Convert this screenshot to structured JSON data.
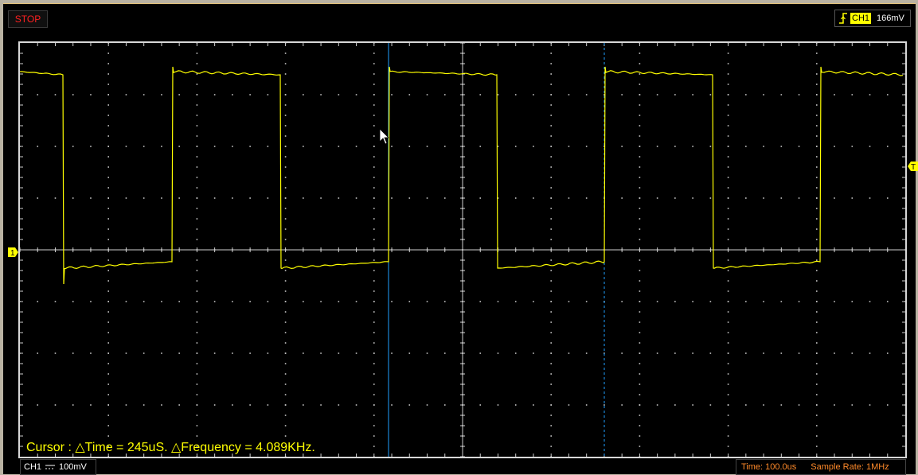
{
  "status": {
    "label": "STOP"
  },
  "trigger": {
    "channel": "CH1",
    "level": "166mV",
    "edge_icon": "rising-edge-icon"
  },
  "channel_marker": {
    "label": "1"
  },
  "trigger_marker": {
    "label": "T"
  },
  "cursor": {
    "readout": "Cursor : △Time = 245uS.  △Frequency = 4.089KHz."
  },
  "channel_info": {
    "channel": "CH1",
    "coupling_icon": "dc-coupling-icon",
    "scale": "100mV"
  },
  "timebase": {
    "time": "Time: 100.0us",
    "sample_rate": "Sample Rate: 1MHz"
  },
  "colors": {
    "trace": "#ffff00",
    "grid": "#d0d0d0",
    "cursor1": "#1fa0ff",
    "cursor2": "#1fa0ff",
    "status_text": "#ff2020",
    "timebase_text": "#ff8a2a"
  }
}
